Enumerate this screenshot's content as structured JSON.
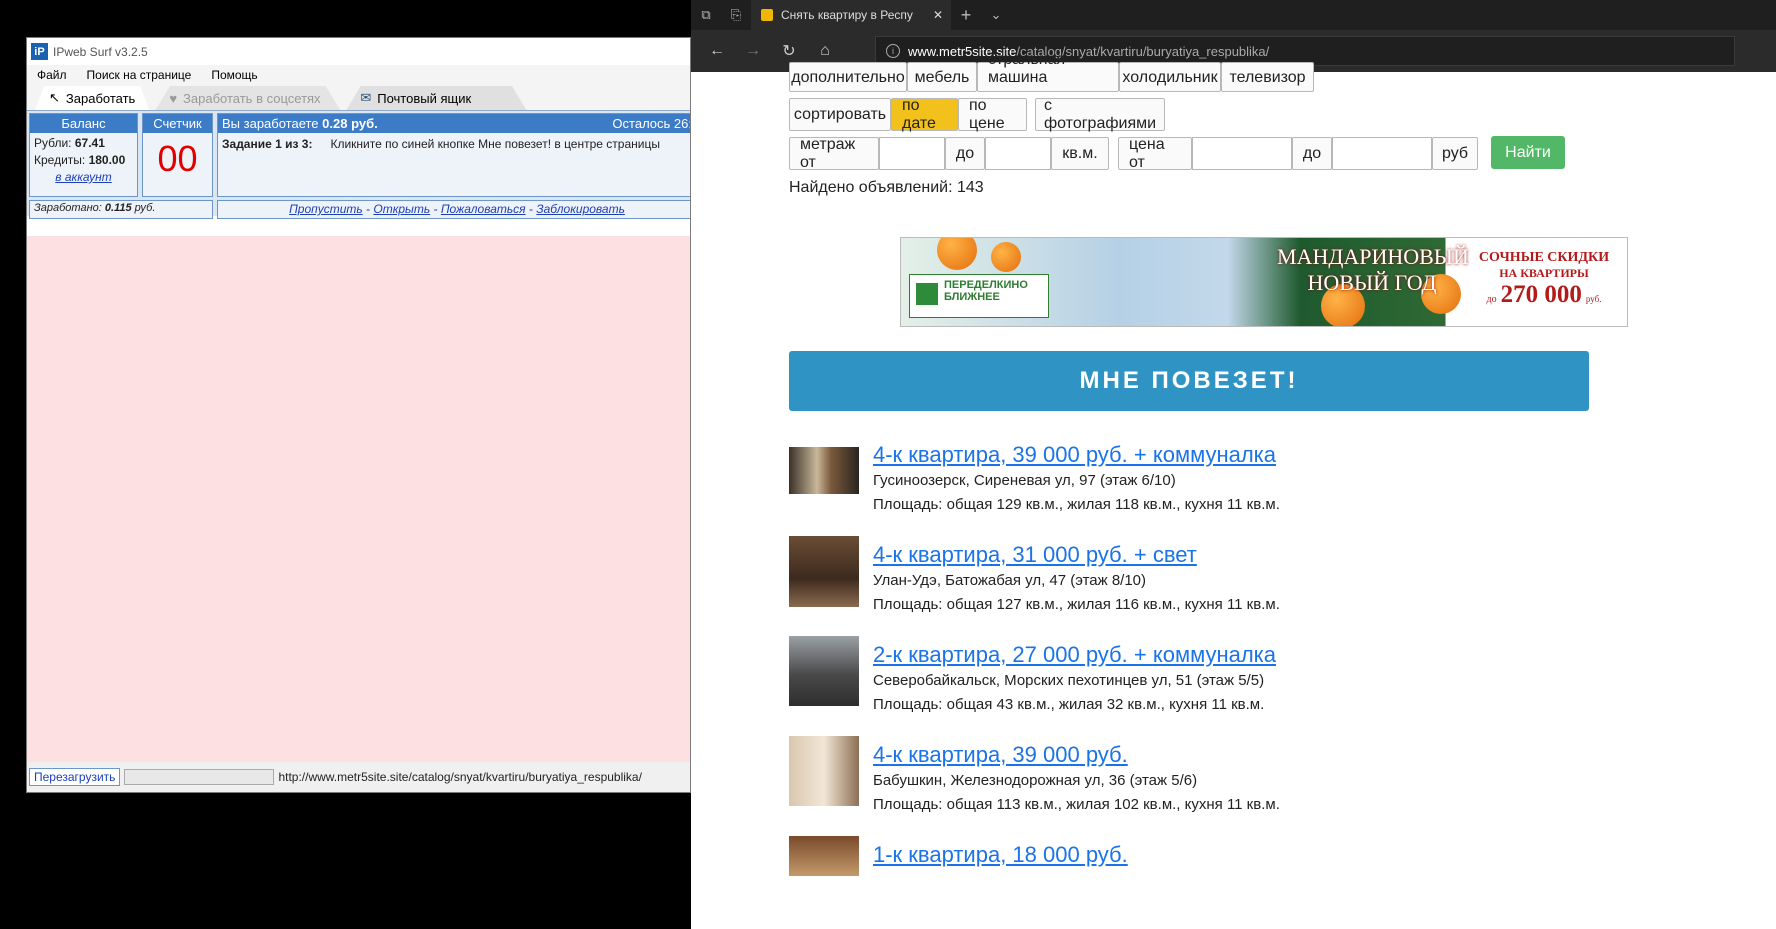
{
  "ipweb": {
    "title": "IPweb Surf v3.2.5",
    "logo": "iP",
    "menu": [
      "Файл",
      "Поиск на странице",
      "Помощь"
    ],
    "tabs": {
      "earn": "Заработать",
      "social": "Заработать в соцсетях",
      "mail": "Почтовый ящик"
    },
    "balance": {
      "header": "Баланс",
      "rub_label": "Рубли:",
      "rub_value": "67.41",
      "credit_label": "Кредиты:",
      "credit_value": "180.00",
      "account_link": "в аккаунт"
    },
    "counter": {
      "header": "Счетчик",
      "value": "00"
    },
    "task": {
      "earn_text": "Вы заработаете",
      "earn_value": "0.28 руб.",
      "remaining": "Осталось 26:",
      "label": "Задание 1 из 3:",
      "instruction": "Кликните по синей кнопке Мне повезет! в центре страницы"
    },
    "earned": {
      "label": "Заработано:",
      "value": "0.115",
      "unit": "руб."
    },
    "links": [
      "Пропустить",
      "Открыть",
      "Пожаловаться",
      "Заблокировать"
    ],
    "status": {
      "reload": "Перезагрузить",
      "url": "http://www.metr5site.site/catalog/snyat/kvartiru/buryatiya_respublika/"
    }
  },
  "browser": {
    "tab_title": "Снять квартиру в Респу",
    "url_host": "www.metr5site.site",
    "url_path": "/catalog/snyat/kvartiru/buryatiya_respublika/"
  },
  "filters": {
    "row1": [
      "дополнительно",
      "мебель",
      "стральная машина",
      "холодильник",
      "телевизор"
    ],
    "sort": [
      "сортировать",
      "по дате",
      "по цене",
      "с фотографиями"
    ],
    "range": {
      "area_from": "метраж от",
      "to": "до",
      "area_unit": "кв.м.",
      "price_from": "цена от",
      "price_unit": "руб"
    },
    "find": "Найти",
    "found": "Найдено объявлений: 143"
  },
  "banner": {
    "logo_line1": "ПЕРЕДЕЛКИНО",
    "logo_line2": "БЛИЖНЕЕ",
    "headline1": "МАНДАРИНОВЫЙ",
    "headline2": "НОВЫЙ ГОД",
    "right1": "СОЧНЫЕ СКИДКИ",
    "right2": "НА КВАРТИРЫ",
    "right_prefix": "до",
    "right_amount": "270 000",
    "right_suffix": "руб."
  },
  "lucky": "МНЕ ПОВЕЗЕТ!",
  "listings": [
    {
      "title": "4-к квартира, 39 000 руб. + коммуналка",
      "address": "Гусиноозерск, Сиреневая ул, 97 (этаж 6/10)",
      "area": "Площадь: общая 129 кв.м., жилая 118 кв.м., кухня 11 кв.м."
    },
    {
      "title": "4-к квартира, 31 000 руб. + свет",
      "address": "Улан-Удэ, Батожабая ул, 47 (этаж 8/10)",
      "area": "Площадь: общая 127 кв.м., жилая 116 кв.м., кухня 11 кв.м."
    },
    {
      "title": "2-к квартира, 27 000 руб. + коммуналка",
      "address": "Северобайкальск, Морских пехотинцев ул, 51 (этаж 5/5)",
      "area": "Площадь: общая 43 кв.м., жилая 32 кв.м., кухня 11 кв.м."
    },
    {
      "title": "4-к квартира, 39 000 руб.",
      "address": "Бабушкин, Железнодорожная ул, 36 (этаж 5/6)",
      "area": "Площадь: общая 113 кв.м., жилая 102 кв.м., кухня 11 кв.м."
    },
    {
      "title": "1-к квартира, 18 000 руб.",
      "address": "",
      "area": ""
    }
  ]
}
